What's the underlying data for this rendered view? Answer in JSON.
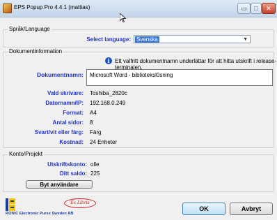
{
  "window": {
    "title": "EPS Popup Pro 4.4.1 (mattias)",
    "controls": {
      "minimize": "▭",
      "maximize": "□",
      "close": "✕"
    }
  },
  "language": {
    "group_label": "Språk/Language",
    "select_label": "Select language:",
    "selected": "Svenska"
  },
  "document": {
    "group_label": "Dokumentinformation",
    "info_text": "Ett valfritt dokumentnamn underlättar för att hitta utskrift i release-terminalen.",
    "name_label": "Dokumentnamn:",
    "name_value": "Microsoft Word - biblioteksl0sning",
    "fields": [
      {
        "label": "Vald skrivare:",
        "value": "Toshiba_2820c"
      },
      {
        "label": "Datornamn/IP:",
        "value": "192.168.0.249"
      },
      {
        "label": "Format:",
        "value": "A4"
      },
      {
        "label": "Antal sidor:",
        "value": "8"
      },
      {
        "label": "Svart/vit eller färg:",
        "value": "Färg"
      },
      {
        "label": "Kostnad:",
        "value": "24 Enheter"
      }
    ]
  },
  "account": {
    "group_label": "Konto/Projekt",
    "account_label": "Utskriftskonto:",
    "account_value": "olle",
    "balance_label": "Ditt saldo:",
    "balance_value": "225",
    "switch_user_button": "Byt användare"
  },
  "footer": {
    "logo_text": "RONIC Electronic Purse Sweden AB",
    "signature_text": "Ex Libris",
    "ok_button": "OK",
    "cancel_button": "Avbryt"
  },
  "colors": {
    "label_blue": "#1f33c8",
    "selection_blue": "#3c78d0"
  }
}
